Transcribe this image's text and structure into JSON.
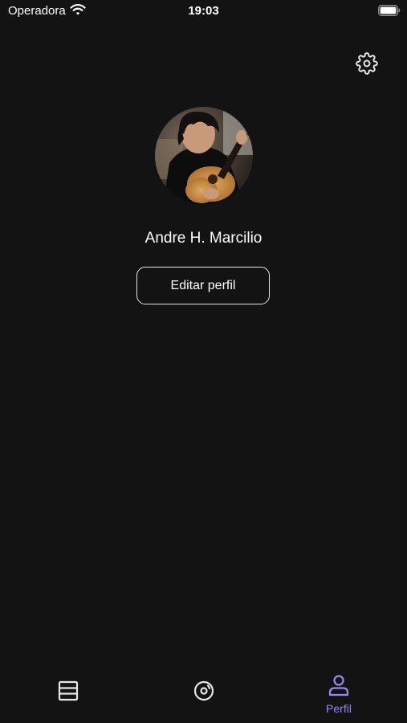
{
  "status_bar": {
    "carrier": "Operadora",
    "time": "19:03"
  },
  "profile": {
    "name": "Andre H. Marcilio",
    "edit_label": "Editar perfil"
  },
  "tabs": [
    {
      "icon": "list-icon",
      "label": "",
      "active": false
    },
    {
      "icon": "disc-icon",
      "label": "",
      "active": false
    },
    {
      "icon": "person-icon",
      "label": "Perfil",
      "active": true
    }
  ],
  "colors": {
    "background": "#131313",
    "accent": "#9a86f0",
    "text": "#ffffff",
    "icon_inactive": "#e6e6e6"
  }
}
